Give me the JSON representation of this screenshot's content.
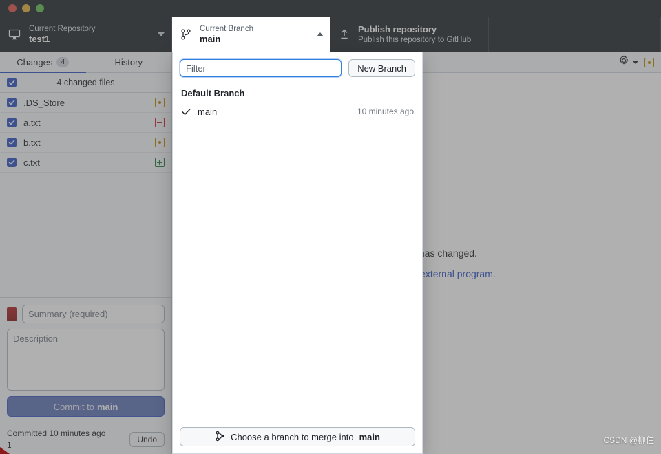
{
  "window": {
    "traffic_lights": [
      "close",
      "minimize",
      "zoom"
    ]
  },
  "toolbar": {
    "repository": {
      "icon": "desktop-monitor-icon",
      "label": "Current Repository",
      "value": "test1",
      "caret": "chevron-down-icon"
    },
    "branch": {
      "icon": "git-branch-icon",
      "label": "Current Branch",
      "value": "main",
      "caret": "chevron-up-icon"
    },
    "publish": {
      "icon": "upload-icon",
      "title": "Publish repository",
      "subtitle": "Publish this repository to GitHub"
    }
  },
  "sidebar": {
    "tabs": [
      {
        "label": "Changes",
        "badge": "4",
        "active": true
      },
      {
        "label": "History",
        "badge": "",
        "active": false
      }
    ],
    "changed_header": {
      "text": "4 changed files",
      "checked": true
    },
    "files": [
      {
        "name": ".DS_Store",
        "checked": true,
        "status": "modified"
      },
      {
        "name": "a.txt",
        "checked": true,
        "status": "deleted"
      },
      {
        "name": "b.txt",
        "checked": true,
        "status": "modified"
      },
      {
        "name": "c.txt",
        "checked": true,
        "status": "new"
      }
    ],
    "commit": {
      "avatar": "user-avatar",
      "summary_value": "",
      "summary_placeholder": "Summary (required)",
      "description_value": "",
      "description_placeholder": "Description",
      "button_prefix": "Commit to ",
      "button_branch": "main"
    },
    "footer": {
      "status_line1": "Committed 10 minutes ago",
      "status_line2": "1",
      "undo_label": "Undo"
    }
  },
  "main": {
    "header": {
      "gear_icon": "gear-icon",
      "caret_icon": "chevron-down-icon",
      "status_icon": "modified-status-icon"
    },
    "message": "The binary file has changed.",
    "link": "Open this file in an external program."
  },
  "branch_dropdown": {
    "filter_value": "",
    "filter_placeholder": "Filter",
    "new_branch_label": "New Branch",
    "section_title": "Default Branch",
    "branches": [
      {
        "name": "main",
        "time": "10 minutes ago",
        "selected": true
      }
    ],
    "merge_prefix": "Choose a branch to merge into ",
    "merge_branch": "main",
    "merge_icon": "git-merge-icon"
  },
  "watermark": {
    "text": "CSDN @柳住"
  },
  "colors": {
    "toolbar_bg": "#24292e",
    "accent": "#2f53c4",
    "modified": "#bf8700",
    "deleted": "#cf222e",
    "new": "#1a7f37",
    "link": "#2f53c4"
  }
}
